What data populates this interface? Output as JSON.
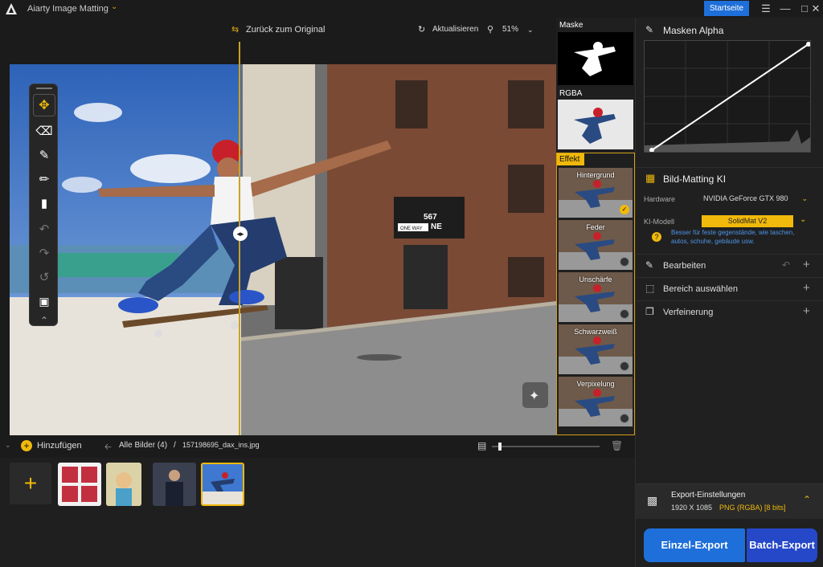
{
  "app": {
    "title": "Aiarty Image Matting",
    "home_label": "Startseite"
  },
  "toolbar": {
    "back_original": "Zurück zum Original",
    "refresh": "Aktualisieren",
    "zoom": "51%"
  },
  "thumb_panel": {
    "mask_label": "Maske",
    "rgba_label": "RGBA",
    "effect_label": "Effekt",
    "effects": [
      "Hintergrund",
      "Feder",
      "Unschärfe",
      "Schwarzweiß",
      "Verpixelung"
    ]
  },
  "photo_text": {
    "sign_number": "567",
    "sign_letters": "NE",
    "oneway": "ONE WAY"
  },
  "right": {
    "alpha_title": "Masken Alpha",
    "matting_title": "Bild-Matting KI",
    "hardware_label": "Hardware",
    "hardware_value": "NVIDIA GeForce GTX 980",
    "model_label": "KI-Modell",
    "model_value": "SolidMat  V2",
    "model_hint": "Besser für feste gegenstände, wie taschen, autos, schuhe, gebäude usw.",
    "sections": [
      "Bearbeiten",
      "Bereich auswählen",
      "Verfeinerung"
    ],
    "export_title": "Export-Einstellungen",
    "export_size": "1920 X 1085",
    "export_format": "PNG (RGBA) [8 bits]",
    "single_export": "Einzel-Export",
    "batch_export": "Batch-Export"
  },
  "bottom": {
    "add_label": "Hinzufügen",
    "all_images": "Alle Bilder (4)",
    "separator": "/",
    "filename": "157198695_dax_ins.jpg"
  },
  "colors": {
    "accent": "#f0b90b",
    "blue": "#1e6fd9",
    "active": "#d4a017"
  }
}
